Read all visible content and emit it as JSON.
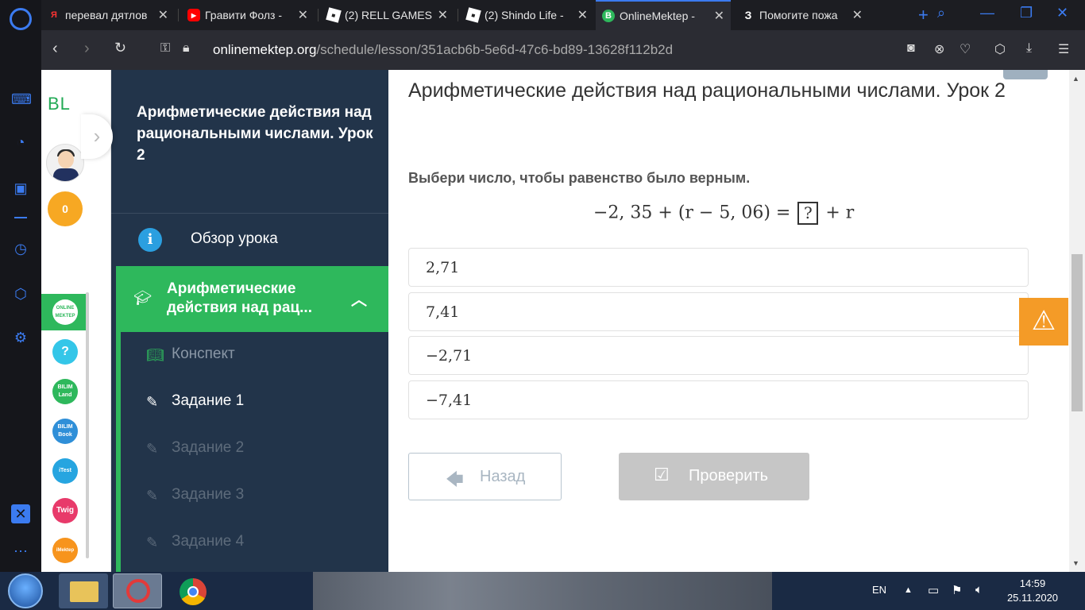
{
  "browser": {
    "tabs": [
      {
        "title": "перевал дятлов",
        "icon": "yandex-icon"
      },
      {
        "title": "Гравити Фолз -",
        "icon": "youtube-icon"
      },
      {
        "title": "(2) RELL GAMES",
        "icon": "roblox-icon"
      },
      {
        "title": "(2) Shindo Life -",
        "icon": "roblox-icon"
      },
      {
        "title": "OnlineMektep -",
        "icon": "onlinemektep-icon",
        "active": true
      },
      {
        "title": "Помогите пожа",
        "icon": "znanija-icon"
      }
    ],
    "url_host": "onlinemektep.org",
    "url_path": "/schedule/lesson/351acb6b-5e6d-47c6-bd89-13628f112b2d"
  },
  "site": {
    "logo": "BL",
    "score": "0",
    "apps": [
      {
        "name": "ONLINE MEKTEP",
        "color": "#2eb85c"
      },
      {
        "name": "?",
        "color": "#34c6e8"
      },
      {
        "name": "BILIM Land",
        "color": "#2eb85c"
      },
      {
        "name": "BILIM Book",
        "color": "#2f8fd8"
      },
      {
        "name": "iTest",
        "color": "#26a5e0"
      },
      {
        "name": "Twig",
        "color": "#e83a6a"
      },
      {
        "name": "iMektep",
        "color": "#f7941d"
      }
    ]
  },
  "course_nav": {
    "title": "Арифметические действия над рациональными числами. Урок 2",
    "overview": "Обзор урока",
    "section": "Арифметические\nдействия над рац...",
    "items": [
      {
        "label": "Конспект",
        "state": "green"
      },
      {
        "label": "Задание 1",
        "state": "current"
      },
      {
        "label": "Задание 2",
        "state": "dim"
      },
      {
        "label": "Задание 3",
        "state": "dim"
      },
      {
        "label": "Задание 4",
        "state": "dim"
      }
    ]
  },
  "main": {
    "lesson_title": "Арифметические действия над рациональными числами. Урок 2",
    "prompt": "Выбери число, чтобы равенство было верным.",
    "equation_left": "−2, 35 + (r − 5, 06) =",
    "equation_box": "?",
    "equation_right": "+ r",
    "answers": [
      "2,71",
      "7,41",
      "−2,71",
      "−7,41"
    ],
    "back_label": "Назад",
    "check_label": "Проверить"
  },
  "taskbar": {
    "lang": "EN",
    "time": "14:59",
    "date": "25.11.2020"
  }
}
